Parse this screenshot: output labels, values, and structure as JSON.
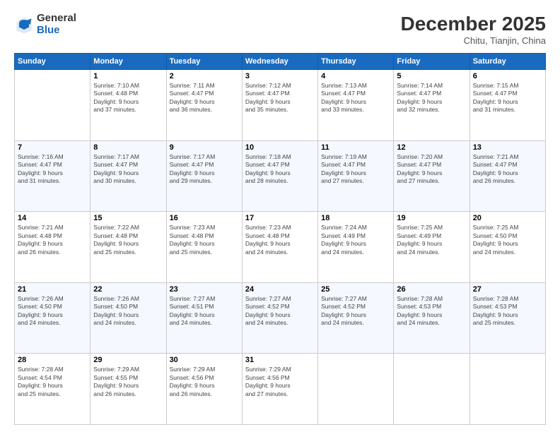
{
  "header": {
    "logo_general": "General",
    "logo_blue": "Blue",
    "month_title": "December 2025",
    "location": "Chitu, Tianjin, China"
  },
  "days_of_week": [
    "Sunday",
    "Monday",
    "Tuesday",
    "Wednesday",
    "Thursday",
    "Friday",
    "Saturday"
  ],
  "weeks": [
    [
      {
        "day": "",
        "sunrise": "",
        "sunset": "",
        "daylight": ""
      },
      {
        "day": "1",
        "sunrise": "Sunrise: 7:10 AM",
        "sunset": "Sunset: 4:48 PM",
        "daylight": "Daylight: 9 hours and 37 minutes."
      },
      {
        "day": "2",
        "sunrise": "Sunrise: 7:11 AM",
        "sunset": "Sunset: 4:47 PM",
        "daylight": "Daylight: 9 hours and 36 minutes."
      },
      {
        "day": "3",
        "sunrise": "Sunrise: 7:12 AM",
        "sunset": "Sunset: 4:47 PM",
        "daylight": "Daylight: 9 hours and 35 minutes."
      },
      {
        "day": "4",
        "sunrise": "Sunrise: 7:13 AM",
        "sunset": "Sunset: 4:47 PM",
        "daylight": "Daylight: 9 hours and 33 minutes."
      },
      {
        "day": "5",
        "sunrise": "Sunrise: 7:14 AM",
        "sunset": "Sunset: 4:47 PM",
        "daylight": "Daylight: 9 hours and 32 minutes."
      },
      {
        "day": "6",
        "sunrise": "Sunrise: 7:15 AM",
        "sunset": "Sunset: 4:47 PM",
        "daylight": "Daylight: 9 hours and 31 minutes."
      }
    ],
    [
      {
        "day": "7",
        "sunrise": "Sunrise: 7:16 AM",
        "sunset": "Sunset: 4:47 PM",
        "daylight": "Daylight: 9 hours and 31 minutes."
      },
      {
        "day": "8",
        "sunrise": "Sunrise: 7:17 AM",
        "sunset": "Sunset: 4:47 PM",
        "daylight": "Daylight: 9 hours and 30 minutes."
      },
      {
        "day": "9",
        "sunrise": "Sunrise: 7:17 AM",
        "sunset": "Sunset: 4:47 PM",
        "daylight": "Daylight: 9 hours and 29 minutes."
      },
      {
        "day": "10",
        "sunrise": "Sunrise: 7:18 AM",
        "sunset": "Sunset: 4:47 PM",
        "daylight": "Daylight: 9 hours and 28 minutes."
      },
      {
        "day": "11",
        "sunrise": "Sunrise: 7:19 AM",
        "sunset": "Sunset: 4:47 PM",
        "daylight": "Daylight: 9 hours and 27 minutes."
      },
      {
        "day": "12",
        "sunrise": "Sunrise: 7:20 AM",
        "sunset": "Sunset: 4:47 PM",
        "daylight": "Daylight: 9 hours and 27 minutes."
      },
      {
        "day": "13",
        "sunrise": "Sunrise: 7:21 AM",
        "sunset": "Sunset: 4:47 PM",
        "daylight": "Daylight: 9 hours and 26 minutes."
      }
    ],
    [
      {
        "day": "14",
        "sunrise": "Sunrise: 7:21 AM",
        "sunset": "Sunset: 4:48 PM",
        "daylight": "Daylight: 9 hours and 26 minutes."
      },
      {
        "day": "15",
        "sunrise": "Sunrise: 7:22 AM",
        "sunset": "Sunset: 4:48 PM",
        "daylight": "Daylight: 9 hours and 25 minutes."
      },
      {
        "day": "16",
        "sunrise": "Sunrise: 7:23 AM",
        "sunset": "Sunset: 4:48 PM",
        "daylight": "Daylight: 9 hours and 25 minutes."
      },
      {
        "day": "17",
        "sunrise": "Sunrise: 7:23 AM",
        "sunset": "Sunset: 4:48 PM",
        "daylight": "Daylight: 9 hours and 24 minutes."
      },
      {
        "day": "18",
        "sunrise": "Sunrise: 7:24 AM",
        "sunset": "Sunset: 4:49 PM",
        "daylight": "Daylight: 9 hours and 24 minutes."
      },
      {
        "day": "19",
        "sunrise": "Sunrise: 7:25 AM",
        "sunset": "Sunset: 4:49 PM",
        "daylight": "Daylight: 9 hours and 24 minutes."
      },
      {
        "day": "20",
        "sunrise": "Sunrise: 7:25 AM",
        "sunset": "Sunset: 4:50 PM",
        "daylight": "Daylight: 9 hours and 24 minutes."
      }
    ],
    [
      {
        "day": "21",
        "sunrise": "Sunrise: 7:26 AM",
        "sunset": "Sunset: 4:50 PM",
        "daylight": "Daylight: 9 hours and 24 minutes."
      },
      {
        "day": "22",
        "sunrise": "Sunrise: 7:26 AM",
        "sunset": "Sunset: 4:50 PM",
        "daylight": "Daylight: 9 hours and 24 minutes."
      },
      {
        "day": "23",
        "sunrise": "Sunrise: 7:27 AM",
        "sunset": "Sunset: 4:51 PM",
        "daylight": "Daylight: 9 hours and 24 minutes."
      },
      {
        "day": "24",
        "sunrise": "Sunrise: 7:27 AM",
        "sunset": "Sunset: 4:52 PM",
        "daylight": "Daylight: 9 hours and 24 minutes."
      },
      {
        "day": "25",
        "sunrise": "Sunrise: 7:27 AM",
        "sunset": "Sunset: 4:52 PM",
        "daylight": "Daylight: 9 hours and 24 minutes."
      },
      {
        "day": "26",
        "sunrise": "Sunrise: 7:28 AM",
        "sunset": "Sunset: 4:53 PM",
        "daylight": "Daylight: 9 hours and 24 minutes."
      },
      {
        "day": "27",
        "sunrise": "Sunrise: 7:28 AM",
        "sunset": "Sunset: 4:53 PM",
        "daylight": "Daylight: 9 hours and 25 minutes."
      }
    ],
    [
      {
        "day": "28",
        "sunrise": "Sunrise: 7:28 AM",
        "sunset": "Sunset: 4:54 PM",
        "daylight": "Daylight: 9 hours and 25 minutes."
      },
      {
        "day": "29",
        "sunrise": "Sunrise: 7:29 AM",
        "sunset": "Sunset: 4:55 PM",
        "daylight": "Daylight: 9 hours and 26 minutes."
      },
      {
        "day": "30",
        "sunrise": "Sunrise: 7:29 AM",
        "sunset": "Sunset: 4:56 PM",
        "daylight": "Daylight: 9 hours and 26 minutes."
      },
      {
        "day": "31",
        "sunrise": "Sunrise: 7:29 AM",
        "sunset": "Sunset: 4:56 PM",
        "daylight": "Daylight: 9 hours and 27 minutes."
      },
      {
        "day": "",
        "sunrise": "",
        "sunset": "",
        "daylight": ""
      },
      {
        "day": "",
        "sunrise": "",
        "sunset": "",
        "daylight": ""
      },
      {
        "day": "",
        "sunrise": "",
        "sunset": "",
        "daylight": ""
      }
    ]
  ]
}
